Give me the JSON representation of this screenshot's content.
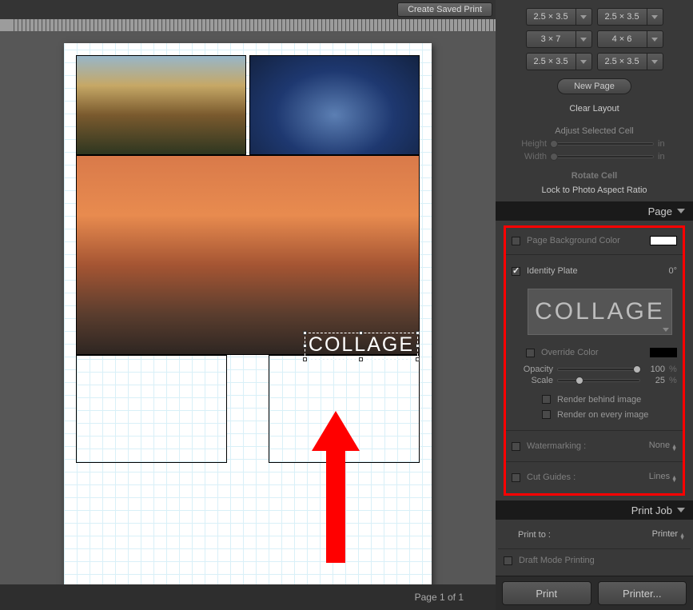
{
  "topBar": {
    "createSavedPrint": "Create Saved Print"
  },
  "cells": {
    "aspectButtons": [
      "2.5 × 3.5",
      "2.5 × 3.5",
      "3 × 7",
      "4 × 6",
      "2.5 × 3.5",
      "2.5 × 3.5"
    ],
    "newPage": "New Page",
    "clearLayout": "Clear Layout",
    "adjustSelectedCell": "Adjust Selected Cell",
    "heightLabel": "Height",
    "widthLabel": "Width",
    "unit": "in",
    "rotateCell": "Rotate Cell",
    "lockAspect": "Lock to Photo Aspect Ratio"
  },
  "pagePanel": {
    "title": "Page",
    "pageBgColor": "Page Background Color",
    "identityPlate": "Identity Plate",
    "identityRotation": "0°",
    "identityText": "COLLAGE",
    "overrideColor": "Override Color",
    "opacityLabel": "Opacity",
    "opacityValue": "100",
    "scaleLabel": "Scale",
    "scaleValue": "25",
    "percent": "%",
    "renderBehind": "Render behind image",
    "renderEvery": "Render on every image",
    "watermarkingLabel": "Watermarking :",
    "watermarkingValue": "None",
    "cutGuidesLabel": "Cut Guides :",
    "cutGuidesValue": "Lines"
  },
  "printJob": {
    "title": "Print Job",
    "printToLabel": "Print to :",
    "printToValue": "Printer",
    "draftMode": "Draft Mode Printing"
  },
  "footer": {
    "pageCount": "Page 1 of 1",
    "printBtn": "Print",
    "printerBtn": "Printer..."
  },
  "canvas": {
    "identityOverlay": "COLLAGE"
  }
}
